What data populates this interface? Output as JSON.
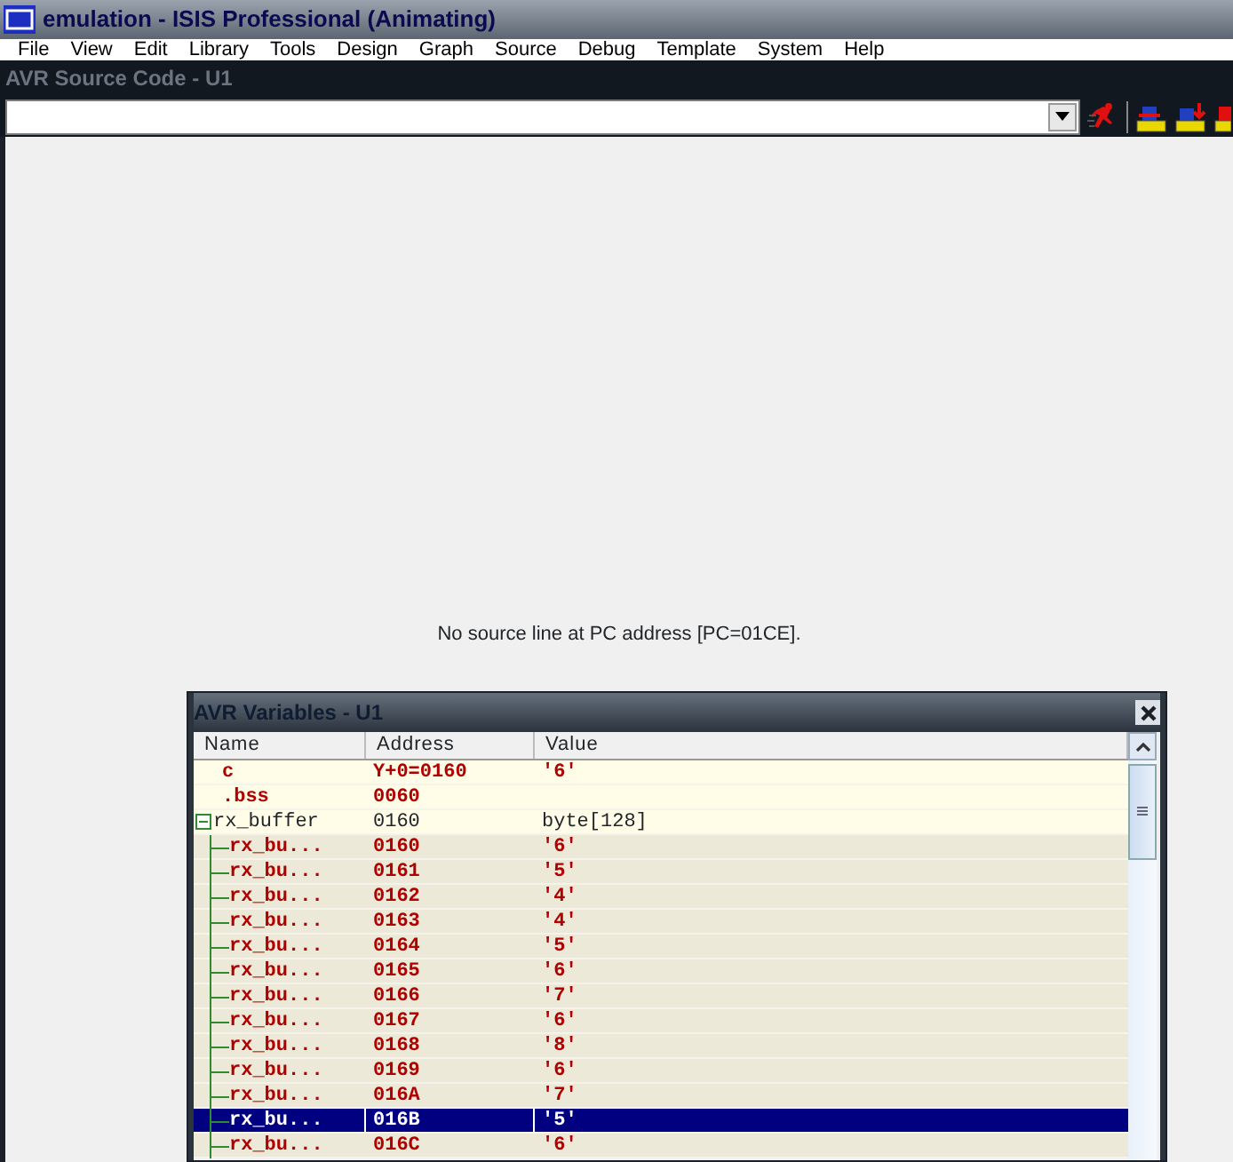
{
  "app_window": {
    "title": "emulation - ISIS Professional (Animating)"
  },
  "menu": [
    "File",
    "View",
    "Edit",
    "Library",
    "Tools",
    "Design",
    "Graph",
    "Source",
    "Debug",
    "Template",
    "System",
    "Help"
  ],
  "source_panel": {
    "title": "AVR Source Code - U1",
    "message": "No source line at PC address [PC=01CE]."
  },
  "variables_window": {
    "title": "AVR Variables - U1",
    "columns": [
      "Name",
      "Address",
      "Value"
    ],
    "rows": [
      {
        "name": "c",
        "address": "Y+0=0160",
        "value": "'6'",
        "changed": true,
        "selected": false
      },
      {
        "name": ".bss",
        "address": "0060",
        "changed": true,
        "selected": false
      },
      {
        "name": "rx_buffer",
        "address": "0160",
        "value": "byte[128]",
        "changed": false,
        "selected": false,
        "expanded": true,
        "children": [
          {
            "name": "rx_bu...",
            "address": "0160",
            "value": "'6'",
            "changed": true,
            "selected": false
          },
          {
            "name": "rx_bu...",
            "address": "0161",
            "value": "'5'",
            "changed": true,
            "selected": false
          },
          {
            "name": "rx_bu...",
            "address": "0162",
            "value": "'4'",
            "changed": true,
            "selected": false
          },
          {
            "name": "rx_bu...",
            "address": "0163",
            "value": "'4'",
            "changed": true,
            "selected": false
          },
          {
            "name": "rx_bu...",
            "address": "0164",
            "value": "'5'",
            "changed": true,
            "selected": false
          },
          {
            "name": "rx_bu...",
            "address": "0165",
            "value": "'6'",
            "changed": true,
            "selected": false
          },
          {
            "name": "rx_bu...",
            "address": "0166",
            "value": "'7'",
            "changed": true,
            "selected": false
          },
          {
            "name": "rx_bu...",
            "address": "0167",
            "value": "'6'",
            "changed": true,
            "selected": false
          },
          {
            "name": "rx_bu...",
            "address": "0168",
            "value": "'8'",
            "changed": true,
            "selected": false
          },
          {
            "name": "rx_bu...",
            "address": "0169",
            "value": "'6'",
            "changed": true,
            "selected": false
          },
          {
            "name": "rx_bu...",
            "address": "016A",
            "value": "'7'",
            "changed": true,
            "selected": false
          },
          {
            "name": "rx_bu...",
            "address": "016B",
            "value": "'5'",
            "changed": true,
            "selected": true
          },
          {
            "name": "rx_bu...",
            "address": "016C",
            "value": "'6'",
            "changed": true,
            "selected": false
          }
        ]
      }
    ]
  }
}
